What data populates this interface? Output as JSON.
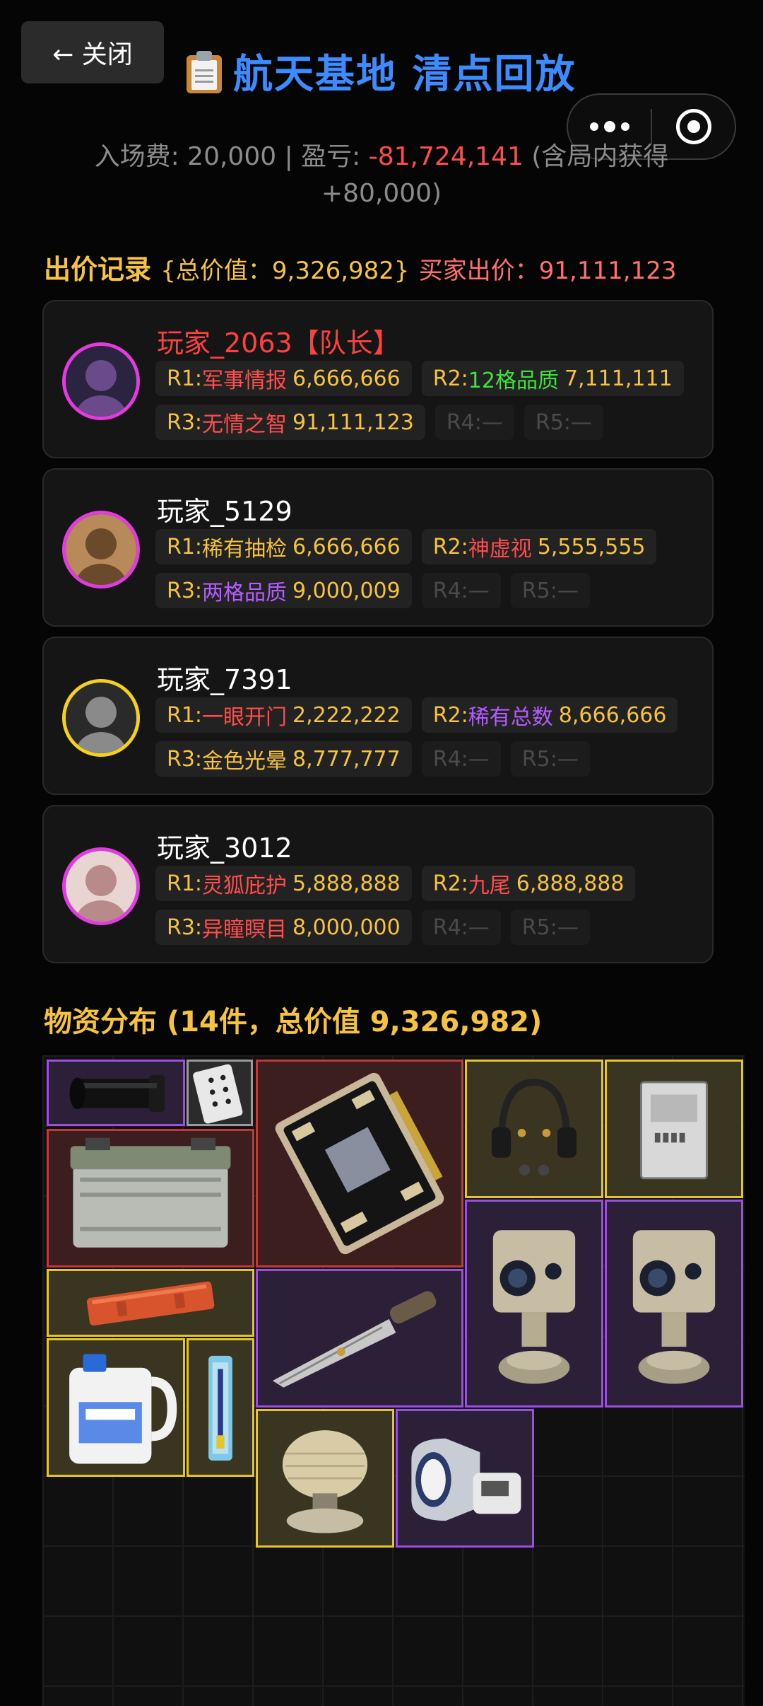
{
  "header": {
    "close_label": "← 关闭",
    "title": "航天基地 清点回放",
    "title_icon": "clipboard-icon",
    "menu_icon": "more-dots-icon",
    "target_icon": "record-target-icon"
  },
  "summary": {
    "fee_label": "入场费: 20,000 | 盈亏: ",
    "pnl": "-81,724,141",
    "extra": " (含局内获得 +80,000)"
  },
  "bids": {
    "title": "出价记录",
    "total": "{总价值：9,326,982}",
    "buyer": "买家出价：91,111,123",
    "players": [
      {
        "name": "玩家_2063【队长】",
        "captain": true,
        "rounds": [
          {
            "prefix": "R1:",
            "item": "军事情报",
            "value": "6,666,666",
            "color": "#ff4d4d"
          },
          {
            "prefix": "R2:",
            "item": "12格品质",
            "value": "7,111,111",
            "color": "#3de23d"
          },
          {
            "prefix": "R3:",
            "item": "无情之智",
            "value": "91,111,123",
            "color": "#ff4d4d"
          },
          {
            "prefix": "R4:",
            "item": "—",
            "value": "",
            "empty": true
          },
          {
            "prefix": "R5:",
            "item": "—",
            "value": "",
            "empty": true
          }
        ]
      },
      {
        "name": "玩家_5129",
        "captain": false,
        "rounds": [
          {
            "prefix": "R1:",
            "item": "稀有抽检",
            "value": "6,666,666",
            "color": "#f5c242"
          },
          {
            "prefix": "R2:",
            "item": "神虚视",
            "value": "5,555,555",
            "color": "#ff4d4d"
          },
          {
            "prefix": "R3:",
            "item": "两格品质",
            "value": "9,000,009",
            "color": "#b45cff"
          },
          {
            "prefix": "R4:",
            "item": "—",
            "value": "",
            "empty": true
          },
          {
            "prefix": "R5:",
            "item": "—",
            "value": "",
            "empty": true
          }
        ]
      },
      {
        "name": "玩家_7391",
        "captain": false,
        "rounds": [
          {
            "prefix": "R1:",
            "item": "一眼开门",
            "value": "2,222,222",
            "color": "#ff4d4d"
          },
          {
            "prefix": "R2:",
            "item": "稀有总数",
            "value": "8,666,666",
            "color": "#b45cff"
          },
          {
            "prefix": "R3:",
            "item": "金色光晕",
            "value": "8,777,777",
            "color": "#f5c242"
          },
          {
            "prefix": "R4:",
            "item": "—",
            "value": "",
            "empty": true
          },
          {
            "prefix": "R5:",
            "item": "—",
            "value": "",
            "empty": true
          }
        ]
      },
      {
        "name": "玩家_3012",
        "captain": false,
        "rounds": [
          {
            "prefix": "R1:",
            "item": "灵狐庇护",
            "value": "5,888,888",
            "color": "#ff4d4d"
          },
          {
            "prefix": "R2:",
            "item": "九尾",
            "value": "6,888,888",
            "color": "#ff4d4d"
          },
          {
            "prefix": "R3:",
            "item": "异瞳瞑目",
            "value": "8,000,000",
            "color": "#ff4d4d"
          },
          {
            "prefix": "R4:",
            "item": "—",
            "value": "",
            "empty": true
          },
          {
            "prefix": "R5:",
            "item": "—",
            "value": "",
            "empty": true
          }
        ]
      }
    ]
  },
  "inventory": {
    "title": "物资分布 (14件，总价值 9,326,982)",
    "items": [
      {
        "name": "camera-lens-item",
        "rarity": "purple"
      },
      {
        "name": "playing-card-item",
        "rarity": "gray"
      },
      {
        "name": "circuit-board-item",
        "rarity": "red"
      },
      {
        "name": "headset-item",
        "rarity": "gold"
      },
      {
        "name": "document-folder-item",
        "rarity": "gold"
      },
      {
        "name": "battery-item",
        "rarity": "red"
      },
      {
        "name": "security-camera-item",
        "rarity": "purple"
      },
      {
        "name": "security-camera-item",
        "rarity": "purple"
      },
      {
        "name": "orange-case-item",
        "rarity": "gold"
      },
      {
        "name": "combat-knife-item",
        "rarity": "purple"
      },
      {
        "name": "liquid-jug-item",
        "rarity": "gold"
      },
      {
        "name": "syringe-item",
        "rarity": "gold"
      },
      {
        "name": "radar-dish-item",
        "rarity": "gold"
      },
      {
        "name": "blood-pressure-monitor-item",
        "rarity": "purple"
      }
    ]
  }
}
